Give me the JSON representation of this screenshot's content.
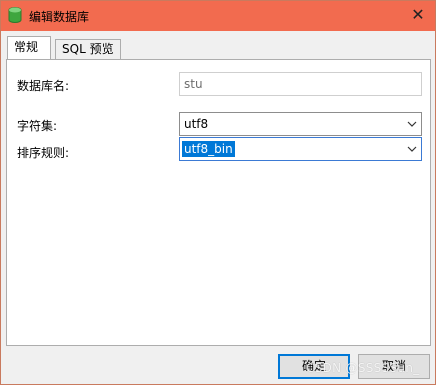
{
  "window": {
    "title": "编辑数据库",
    "close_glyph": "✕",
    "app_icon": "database-icon",
    "titlebar_color": "#f26b4f"
  },
  "tabs": [
    {
      "label": "常规",
      "active": true
    },
    {
      "label": "SQL 预览",
      "active": false
    }
  ],
  "form": {
    "db_name_label": "数据库名:",
    "db_name_value": "stu",
    "charset_label": "字符集:",
    "charset_value": "utf8",
    "collation_label": "排序规则:",
    "collation_value": "utf8_bin"
  },
  "buttons": {
    "ok_label": "确定",
    "cancel_label": "取消"
  },
  "watermark": "CSDN @SSSSSun_",
  "colors": {
    "selection": "#0078d7",
    "focus_border": "#3b7ad4"
  }
}
